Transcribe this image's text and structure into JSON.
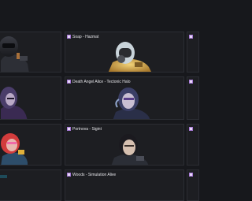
{
  "colors": {
    "background": "#17181c",
    "card_bg": "#1d1e22",
    "card_border": "#2b2d33",
    "rarity_accent": "#a679d6",
    "label_text": "#e4e4e8"
  },
  "grid": {
    "cards": [
      {
        "label": "",
        "icon": "operator-rarity-icon",
        "portrait": "soldier-dark-helmet"
      },
      {
        "label": "Soap - Hazmat",
        "icon": "operator-rarity-icon",
        "portrait": "gold-hazmat-suit"
      },
      {
        "label": "",
        "icon": "operator-rarity-icon",
        "portrait": ""
      },
      {
        "label": "",
        "icon": "operator-rarity-icon",
        "portrait": "purple-hooded-figure"
      },
      {
        "label": "Death Angel Alice - Tectonic Halo",
        "icon": "operator-rarity-icon",
        "portrait": "purple-halo-female"
      },
      {
        "label": "",
        "icon": "operator-rarity-icon",
        "portrait": ""
      },
      {
        "label": "",
        "icon": "operator-rarity-icon",
        "portrait": "red-pink-operator"
      },
      {
        "label": "Portnova - Sigint",
        "icon": "operator-rarity-icon",
        "portrait": "dark-haired-female"
      },
      {
        "label": "",
        "icon": "operator-rarity-icon",
        "portrait": ""
      },
      {
        "label": "",
        "icon": "operator-rarity-icon",
        "portrait": ""
      },
      {
        "label": "Woods - Simulation Alive",
        "icon": "operator-rarity-icon",
        "portrait": ""
      },
      {
        "label": "",
        "icon": "operator-rarity-icon",
        "portrait": ""
      }
    ]
  }
}
